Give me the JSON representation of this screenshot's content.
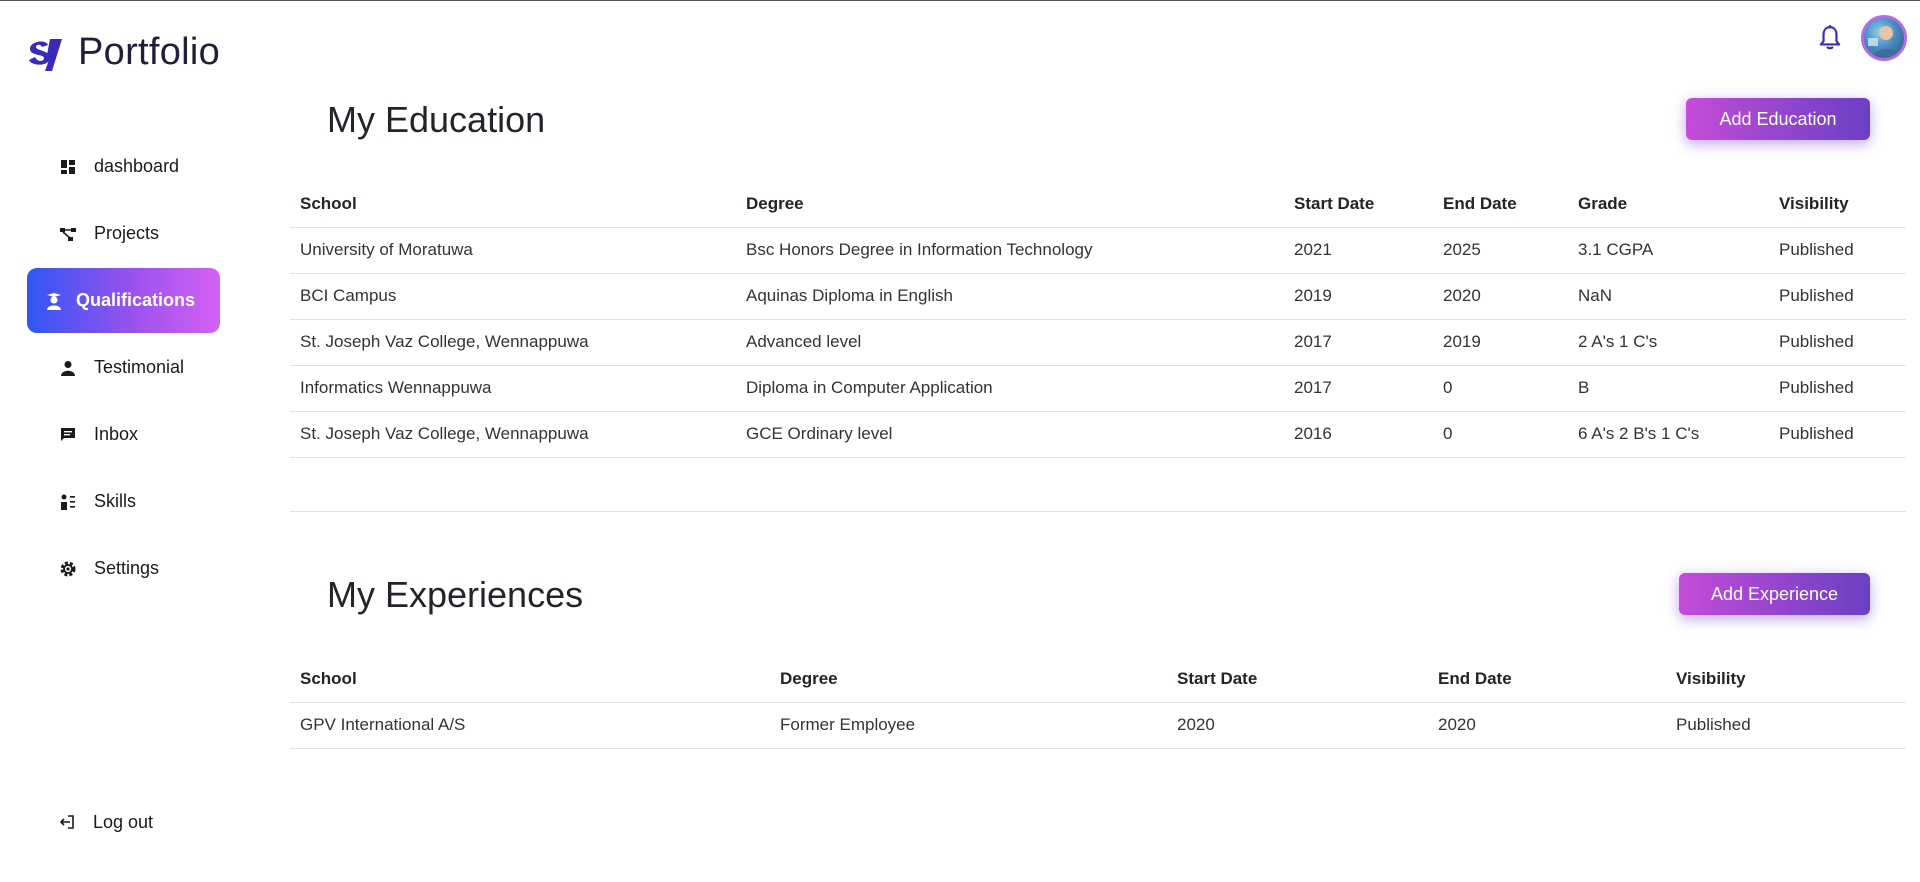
{
  "header": {
    "brand": "Portfolio",
    "brand_mark": "sy-logo",
    "notification_icon": "bell-icon",
    "avatar_icon": "user-avatar"
  },
  "sidebar": {
    "items": [
      {
        "label": "dashboard",
        "icon": "dashboard-icon"
      },
      {
        "label": "Projects",
        "icon": "projects-icon"
      },
      {
        "label": "Qualifications",
        "icon": "qualifications-icon",
        "active": true
      },
      {
        "label": "Testimonial",
        "icon": "person-icon"
      },
      {
        "label": "Inbox",
        "icon": "chat-icon"
      },
      {
        "label": "Skills",
        "icon": "skills-icon"
      },
      {
        "label": "Settings",
        "icon": "gear-icon"
      }
    ],
    "logout": {
      "label": "Log out",
      "icon": "logout-icon"
    }
  },
  "education": {
    "title": "My Education",
    "add_label": "Add Education",
    "columns": [
      "School",
      "Degree",
      "Start Date",
      "End Date",
      "Grade",
      "Visibility"
    ],
    "rows": [
      [
        "University of Moratuwa",
        "Bsc Honors Degree in Information Technology",
        "2021",
        "2025",
        "3.1 CGPA",
        "Published"
      ],
      [
        "BCI Campus",
        "Aquinas Diploma in English",
        "2019",
        "2020",
        "NaN",
        "Published"
      ],
      [
        "St. Joseph Vaz College, Wennappuwa",
        "Advanced level",
        "2017",
        "2019",
        "2 A's 1 C's",
        "Published"
      ],
      [
        "Informatics Wennappuwa",
        "Diploma in Computer Application",
        "2017",
        "0",
        "B",
        "Published"
      ],
      [
        "St. Joseph Vaz College, Wennappuwa",
        "GCE Ordinary level",
        "2016",
        "0",
        "6 A's 2 B's 1 C's",
        "Published"
      ]
    ]
  },
  "experience": {
    "title": "My Experiences",
    "add_label": "Add Experience",
    "columns": [
      "School",
      "Degree",
      "Start Date",
      "End Date",
      "Visibility"
    ],
    "rows": [
      [
        "GPV International A/S",
        "Former Employee",
        "2020",
        "2020",
        "Published"
      ]
    ]
  },
  "colors": {
    "active_gradient_start": "#2f56f5",
    "active_gradient_end": "#d461f5",
    "button_gradient_start": "#c44cd8",
    "button_gradient_end": "#6a3fc4",
    "brand": "#3b2ab8"
  }
}
